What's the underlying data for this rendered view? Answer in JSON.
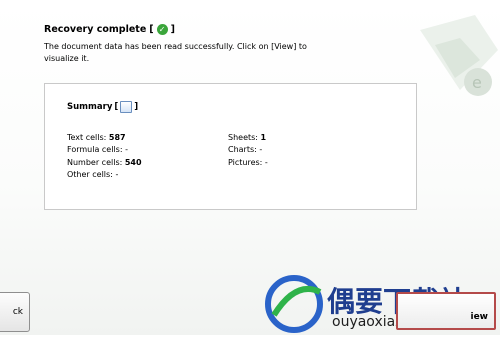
{
  "header": {
    "title": "Recovery complete",
    "open_bracket": "[",
    "close_bracket": "]",
    "description": "The document data has been read successfully. Click on [View] to visualize it."
  },
  "summary": {
    "title": "Summary",
    "open_bracket": "[",
    "close_bracket": "]",
    "left": [
      {
        "label": "Text cells:",
        "value": "587"
      },
      {
        "label": "Formula cells:",
        "value": "-"
      },
      {
        "label": "Number cells:",
        "value": "540"
      },
      {
        "label": "Other cells:",
        "value": "-"
      }
    ],
    "right": [
      {
        "label": "Sheets:",
        "value": "1"
      },
      {
        "label": "Charts:",
        "value": "-"
      },
      {
        "label": "Pictures:",
        "value": "-"
      }
    ]
  },
  "buttons": {
    "back": "ck",
    "view": "iew"
  },
  "watermark": {
    "title": "偶要下载站",
    "url": "ouyaoxiazai.com"
  }
}
